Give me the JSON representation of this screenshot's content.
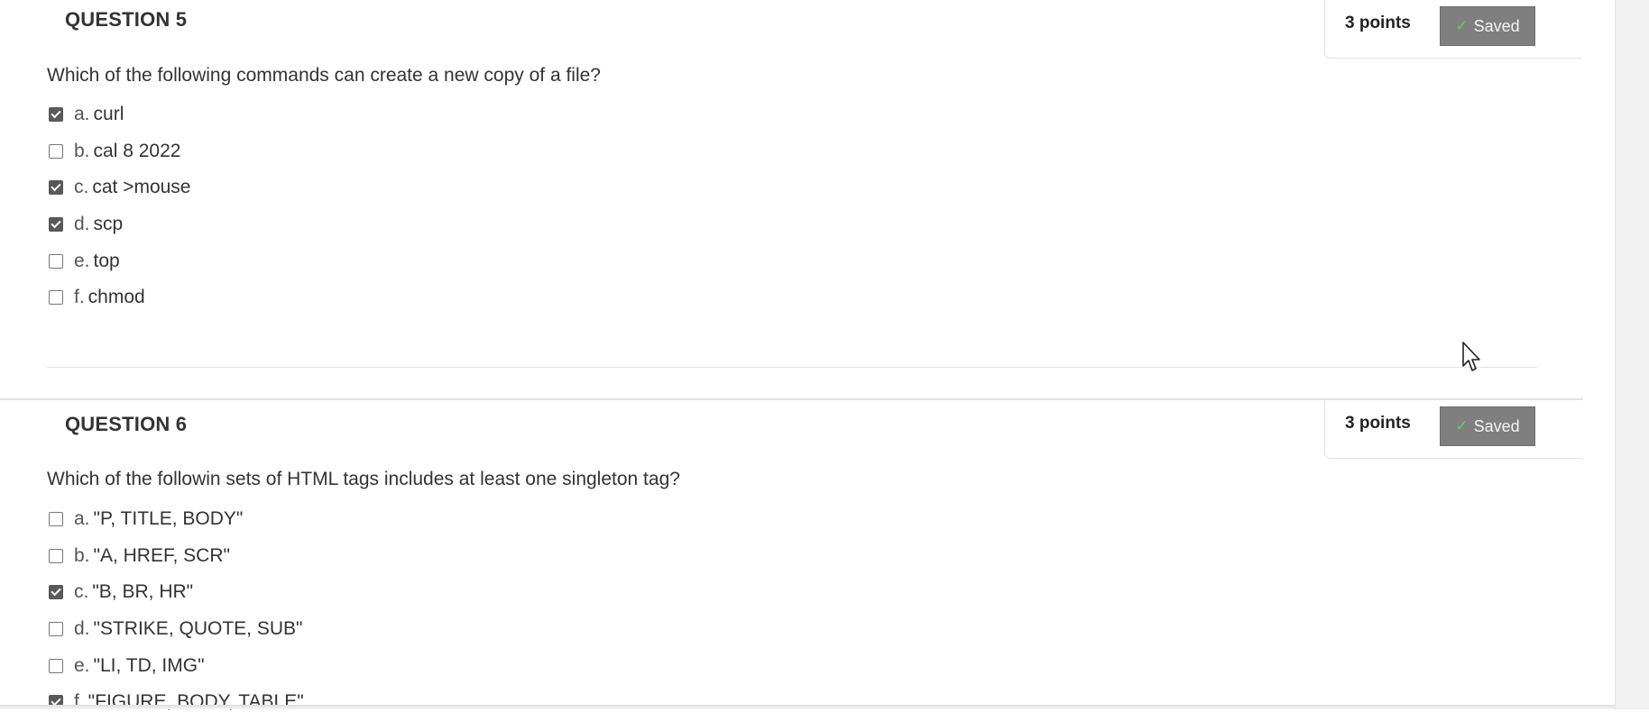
{
  "questions": [
    {
      "title": "QUESTION 5",
      "points": "3 points",
      "saved_label": "Saved",
      "text": "Which of the following commands can create a new copy of a file?",
      "options": [
        {
          "letter": "a.",
          "text": "curl",
          "checked": true
        },
        {
          "letter": "b.",
          "text": "cal  8  2022",
          "checked": false
        },
        {
          "letter": "c.",
          "text": "cat  >mouse",
          "checked": true
        },
        {
          "letter": "d.",
          "text": "scp",
          "checked": true
        },
        {
          "letter": "e.",
          "text": "top",
          "checked": false
        },
        {
          "letter": "f.",
          "text": " chmod",
          "checked": false
        }
      ]
    },
    {
      "title": "QUESTION 6",
      "points": "3 points",
      "saved_label": "Saved",
      "text": "Which of the followin sets of HTML tags includes at least one singleton tag?",
      "options": [
        {
          "letter": "a.",
          "text": "\"P, TITLE, BODY\"",
          "checked": false
        },
        {
          "letter": "b.",
          "text": "\"A, HREF, SCR\"",
          "checked": false
        },
        {
          "letter": "c.",
          "text": "\"B, BR, HR\"",
          "checked": true
        },
        {
          "letter": "d.",
          "text": "\"STRIKE, QUOTE, SUB\"",
          "checked": false
        },
        {
          "letter": "e.",
          "text": "\"LI, TD, IMG\"",
          "checked": false
        },
        {
          "letter": "f.",
          "text": "\"FIGURE, BODY, TABLE\"",
          "checked": true
        }
      ]
    }
  ],
  "colors": {
    "saved_button_bg": "#7f7f7f",
    "saved_check": "#5ed35e",
    "checkbox_checked": "#595959"
  },
  "icons": {
    "saved": "check-icon",
    "cursor": "mouse-pointer-icon"
  }
}
